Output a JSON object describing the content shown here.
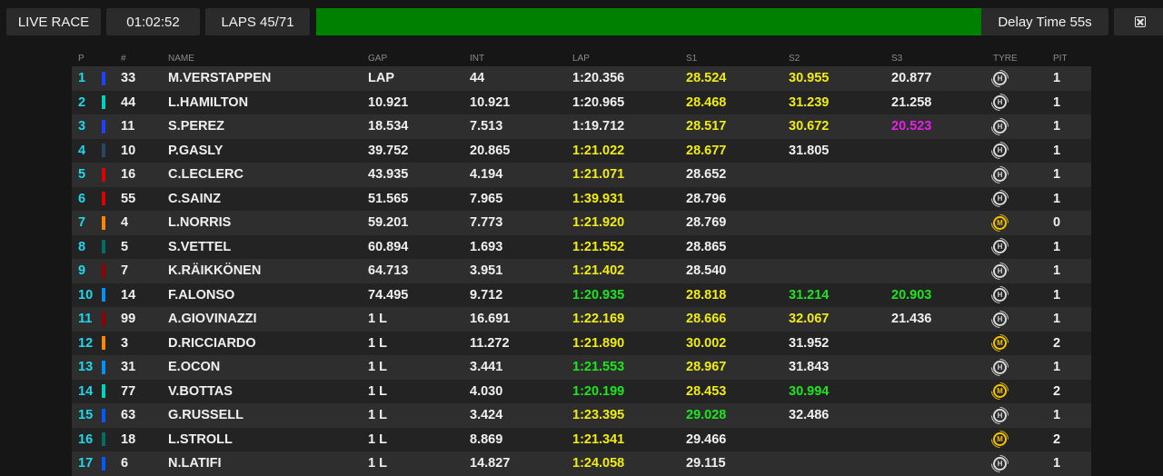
{
  "topbar": {
    "live_label": "LIVE RACE",
    "time": "01:02:52",
    "laps": "LAPS 45/71",
    "progress": 1.0,
    "delay": "Delay Time 55s"
  },
  "headers": {
    "pos": "P",
    "num": "#",
    "name": "NAME",
    "gap": "GAP",
    "int": "INT",
    "lap": "LAP",
    "s1": "S1",
    "s2": "S2",
    "s3": "S3",
    "tyre": "TYRE",
    "pit": "PIT"
  },
  "colors": {
    "yellow": "#f0ec14",
    "green": "#1ee61e",
    "purple": "#e81fe8",
    "position": "#1ed8ee",
    "progress": "#008000"
  },
  "rows": [
    {
      "pos": "1",
      "num": "33",
      "name": "M.VERSTAPPEN",
      "gap": "LAP",
      "int": "44",
      "lap": "1:20.356",
      "lap_c": "white",
      "s1": "28.524",
      "s1_c": "yellow",
      "s2": "30.955",
      "s2_c": "yellow",
      "s3": "20.877",
      "s3_c": "white",
      "tyre": "H",
      "pit": "1",
      "team": "#1e41ff"
    },
    {
      "pos": "2",
      "num": "44",
      "name": "L.HAMILTON",
      "gap": "10.921",
      "int": "10.921",
      "lap": "1:20.965",
      "lap_c": "white",
      "s1": "28.468",
      "s1_c": "yellow",
      "s2": "31.239",
      "s2_c": "yellow",
      "s3": "21.258",
      "s3_c": "white",
      "tyre": "H",
      "pit": "1",
      "team": "#00d2be"
    },
    {
      "pos": "3",
      "num": "11",
      "name": "S.PEREZ",
      "gap": "18.534",
      "int": "7.513",
      "lap": "1:19.712",
      "lap_c": "white",
      "s1": "28.517",
      "s1_c": "yellow",
      "s2": "30.672",
      "s2_c": "yellow",
      "s3": "20.523",
      "s3_c": "purple",
      "tyre": "H",
      "pit": "1",
      "team": "#1e41ff"
    },
    {
      "pos": "4",
      "num": "10",
      "name": "P.GASLY",
      "gap": "39.752",
      "int": "20.865",
      "lap": "1:21.022",
      "lap_c": "yellow",
      "s1": "28.677",
      "s1_c": "yellow",
      "s2": "31.805",
      "s2_c": "white",
      "s3": "",
      "s3_c": "white",
      "tyre": "H",
      "pit": "1",
      "team": "#2b4562"
    },
    {
      "pos": "5",
      "num": "16",
      "name": "C.LECLERC",
      "gap": "43.935",
      "int": "4.194",
      "lap": "1:21.071",
      "lap_c": "yellow",
      "s1": "28.652",
      "s1_c": "white",
      "s2": "",
      "s2_c": "white",
      "s3": "",
      "s3_c": "white",
      "tyre": "H",
      "pit": "1",
      "team": "#dc0000"
    },
    {
      "pos": "6",
      "num": "55",
      "name": "C.SAINZ",
      "gap": "51.565",
      "int": "7.965",
      "lap": "1:39.931",
      "lap_c": "yellow",
      "s1": "28.796",
      "s1_c": "white",
      "s2": "",
      "s2_c": "white",
      "s3": "",
      "s3_c": "white",
      "tyre": "H",
      "pit": "1",
      "team": "#dc0000"
    },
    {
      "pos": "7",
      "num": "4",
      "name": "L.NORRIS",
      "gap": "59.201",
      "int": "7.773",
      "lap": "1:21.920",
      "lap_c": "yellow",
      "s1": "28.769",
      "s1_c": "white",
      "s2": "",
      "s2_c": "white",
      "s3": "",
      "s3_c": "white",
      "tyre": "M",
      "pit": "0",
      "team": "#ff8700"
    },
    {
      "pos": "8",
      "num": "5",
      "name": "S.VETTEL",
      "gap": "60.894",
      "int": "1.693",
      "lap": "1:21.552",
      "lap_c": "yellow",
      "s1": "28.865",
      "s1_c": "white",
      "s2": "",
      "s2_c": "white",
      "s3": "",
      "s3_c": "white",
      "tyre": "H",
      "pit": "1",
      "team": "#006f62"
    },
    {
      "pos": "9",
      "num": "7",
      "name": "K.RÄIKKÖNEN",
      "gap": "64.713",
      "int": "3.951",
      "lap": "1:21.402",
      "lap_c": "yellow",
      "s1": "28.540",
      "s1_c": "white",
      "s2": "",
      "s2_c": "white",
      "s3": "",
      "s3_c": "white",
      "tyre": "H",
      "pit": "1",
      "team": "#900000"
    },
    {
      "pos": "10",
      "num": "14",
      "name": "F.ALONSO",
      "gap": "74.495",
      "int": "9.712",
      "lap": "1:20.935",
      "lap_c": "green",
      "s1": "28.818",
      "s1_c": "yellow",
      "s2": "31.214",
      "s2_c": "green",
      "s3": "20.903",
      "s3_c": "green",
      "tyre": "H",
      "pit": "1",
      "team": "#0090ff"
    },
    {
      "pos": "11",
      "num": "99",
      "name": "A.GIOVINAZZI",
      "gap": "1 L",
      "int": "16.691",
      "lap": "1:22.169",
      "lap_c": "yellow",
      "s1": "28.666",
      "s1_c": "yellow",
      "s2": "32.067",
      "s2_c": "yellow",
      "s3": "21.436",
      "s3_c": "white",
      "tyre": "H",
      "pit": "1",
      "team": "#900000"
    },
    {
      "pos": "12",
      "num": "3",
      "name": "D.RICCIARDO",
      "gap": "1 L",
      "int": "11.272",
      "lap": "1:21.890",
      "lap_c": "yellow",
      "s1": "30.002",
      "s1_c": "yellow",
      "s2": "31.952",
      "s2_c": "white",
      "s3": "",
      "s3_c": "white",
      "tyre": "M",
      "pit": "2",
      "team": "#ff8700"
    },
    {
      "pos": "13",
      "num": "31",
      "name": "E.OCON",
      "gap": "1 L",
      "int": "3.441",
      "lap": "1:21.553",
      "lap_c": "green",
      "s1": "28.967",
      "s1_c": "yellow",
      "s2": "31.843",
      "s2_c": "white",
      "s3": "",
      "s3_c": "white",
      "tyre": "H",
      "pit": "1",
      "team": "#0090ff"
    },
    {
      "pos": "14",
      "num": "77",
      "name": "V.BOTTAS",
      "gap": "1 L",
      "int": "4.030",
      "lap": "1:20.199",
      "lap_c": "green",
      "s1": "28.453",
      "s1_c": "yellow",
      "s2": "30.994",
      "s2_c": "green",
      "s3": "",
      "s3_c": "white",
      "tyre": "M",
      "pit": "2",
      "team": "#00d2be"
    },
    {
      "pos": "15",
      "num": "63",
      "name": "G.RUSSELL",
      "gap": "1 L",
      "int": "3.424",
      "lap": "1:23.395",
      "lap_c": "yellow",
      "s1": "29.028",
      "s1_c": "green",
      "s2": "32.486",
      "s2_c": "white",
      "s3": "",
      "s3_c": "white",
      "tyre": "H",
      "pit": "1",
      "team": "#005aff"
    },
    {
      "pos": "16",
      "num": "18",
      "name": "L.STROLL",
      "gap": "1 L",
      "int": "8.869",
      "lap": "1:21.341",
      "lap_c": "yellow",
      "s1": "29.466",
      "s1_c": "white",
      "s2": "",
      "s2_c": "white",
      "s3": "",
      "s3_c": "white",
      "tyre": "M",
      "pit": "2",
      "team": "#006f62"
    },
    {
      "pos": "17",
      "num": "6",
      "name": "N.LATIFI",
      "gap": "1 L",
      "int": "14.827",
      "lap": "1:24.058",
      "lap_c": "yellow",
      "s1": "29.115",
      "s1_c": "white",
      "s2": "",
      "s2_c": "white",
      "s3": "",
      "s3_c": "white",
      "tyre": "H",
      "pit": "1",
      "team": "#005aff"
    }
  ]
}
